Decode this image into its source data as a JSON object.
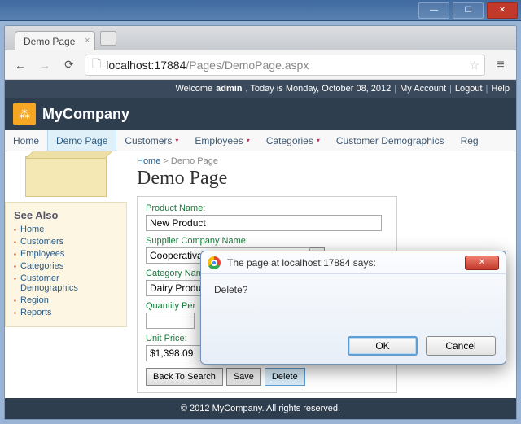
{
  "window": {
    "title": ""
  },
  "browser": {
    "tab_title": "Demo Page",
    "url_host": "localhost:",
    "url_port": "17884",
    "url_path": "/Pages/DemoPage.aspx"
  },
  "userbar": {
    "welcome": "Welcome ",
    "username": "admin",
    "date_text": ", Today is Monday, October 08, 2012",
    "my_account": "My Account",
    "logout": "Logout",
    "help": "Help"
  },
  "brand": "MyCompany",
  "menu": {
    "items": [
      {
        "label": "Home"
      },
      {
        "label": "Demo Page",
        "active": true
      },
      {
        "label": "Customers",
        "dropdown": true
      },
      {
        "label": "Employees",
        "dropdown": true
      },
      {
        "label": "Categories",
        "dropdown": true
      },
      {
        "label": "Customer Demographics"
      },
      {
        "label": "Reg",
        "dropdown": true
      }
    ]
  },
  "sidebar": {
    "heading": "See Also",
    "items": [
      "Home",
      "Customers",
      "Employees",
      "Categories",
      "Customer Demographics",
      "Region",
      "Reports"
    ]
  },
  "breadcrumb": {
    "home": "Home",
    "sep": ">",
    "current": "Demo Page"
  },
  "page_title": "Demo Page",
  "form": {
    "product_name": {
      "label": "Product Name:",
      "value": "New Product"
    },
    "supplier": {
      "label": "Supplier Company Name:",
      "value": "Cooperativa de Quesos 'Las Cabras'"
    },
    "category": {
      "label": "Category Name:",
      "value": "Dairy Produc"
    },
    "quantity": {
      "label": "Quantity Per",
      "value": ""
    },
    "unit_price": {
      "label": "Unit Price:",
      "value": "$1,398.09"
    },
    "buttons": {
      "back": "Back To Search",
      "save": "Save",
      "delete": "Delete"
    }
  },
  "footer": "© 2012 MyCompany. All rights reserved.",
  "alert": {
    "title": "The page at localhost:17884 says:",
    "message": "Delete?",
    "ok": "OK",
    "cancel": "Cancel"
  }
}
